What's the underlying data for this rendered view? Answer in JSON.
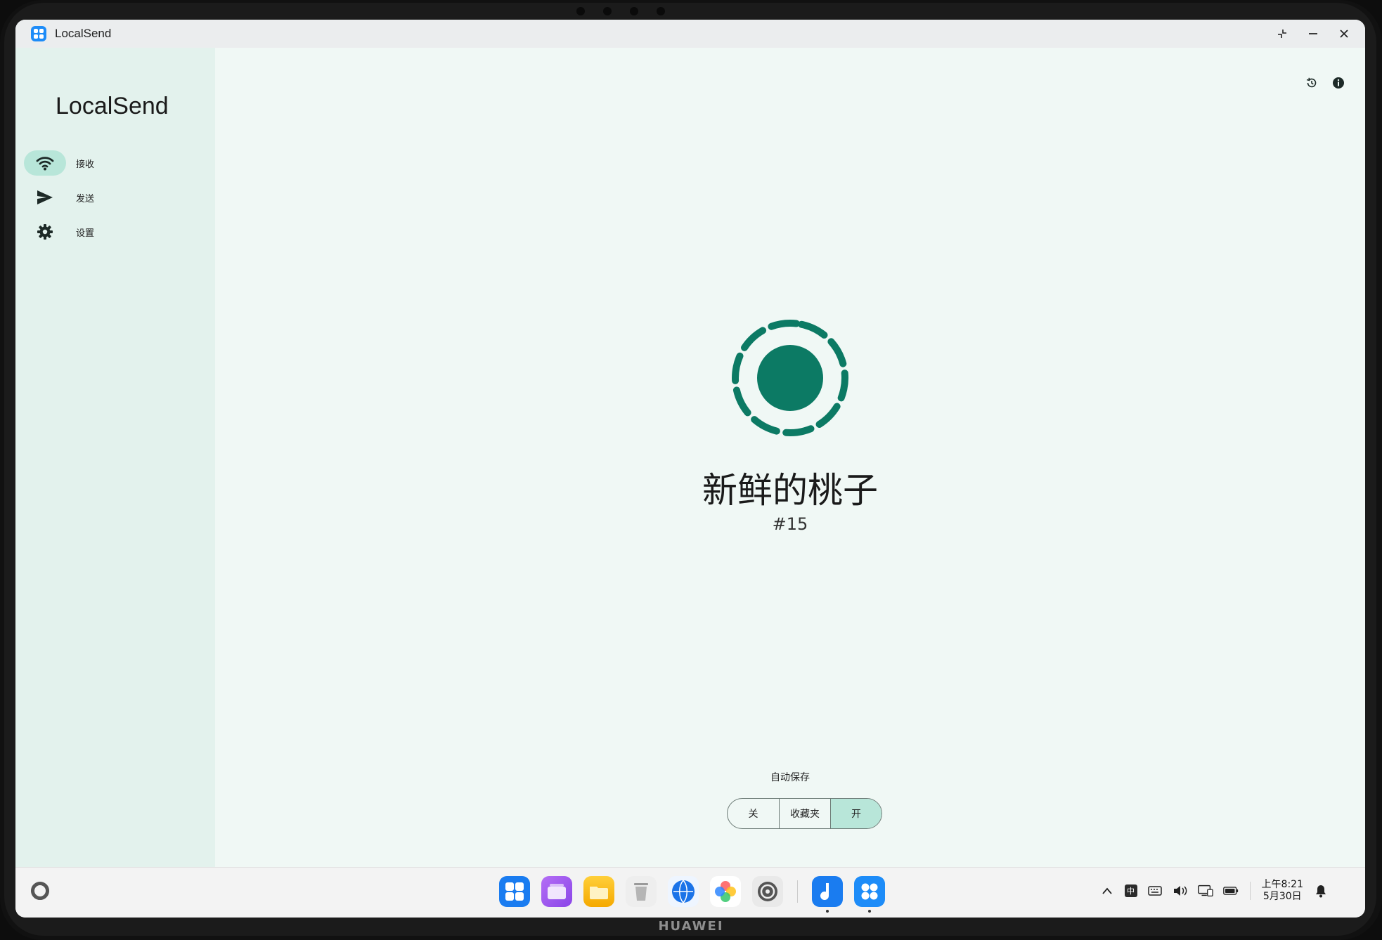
{
  "window": {
    "title": "LocalSend"
  },
  "sidebar": {
    "logo": "LocalSend",
    "items": [
      {
        "label": "接收",
        "icon": "wifi-icon",
        "active": true
      },
      {
        "label": "发送",
        "icon": "send-icon",
        "active": false
      },
      {
        "label": "设置",
        "icon": "gear-icon",
        "active": false
      }
    ]
  },
  "main": {
    "device_name": "新鲜的桃子",
    "device_number": "#15",
    "autosave": {
      "label": "自动保存",
      "options": [
        "关",
        "收藏夹",
        "开"
      ],
      "selected": "开"
    }
  },
  "taskbar": {
    "time": "上午8:21",
    "date": "5月30日",
    "ime": "中"
  },
  "device_brand": "HUAWEI",
  "colors": {
    "accent": "#0c7a64",
    "selected_bg": "#b8e6d9",
    "sidebar_bg": "#e3f2ed",
    "main_bg": "#f0f8f5"
  }
}
